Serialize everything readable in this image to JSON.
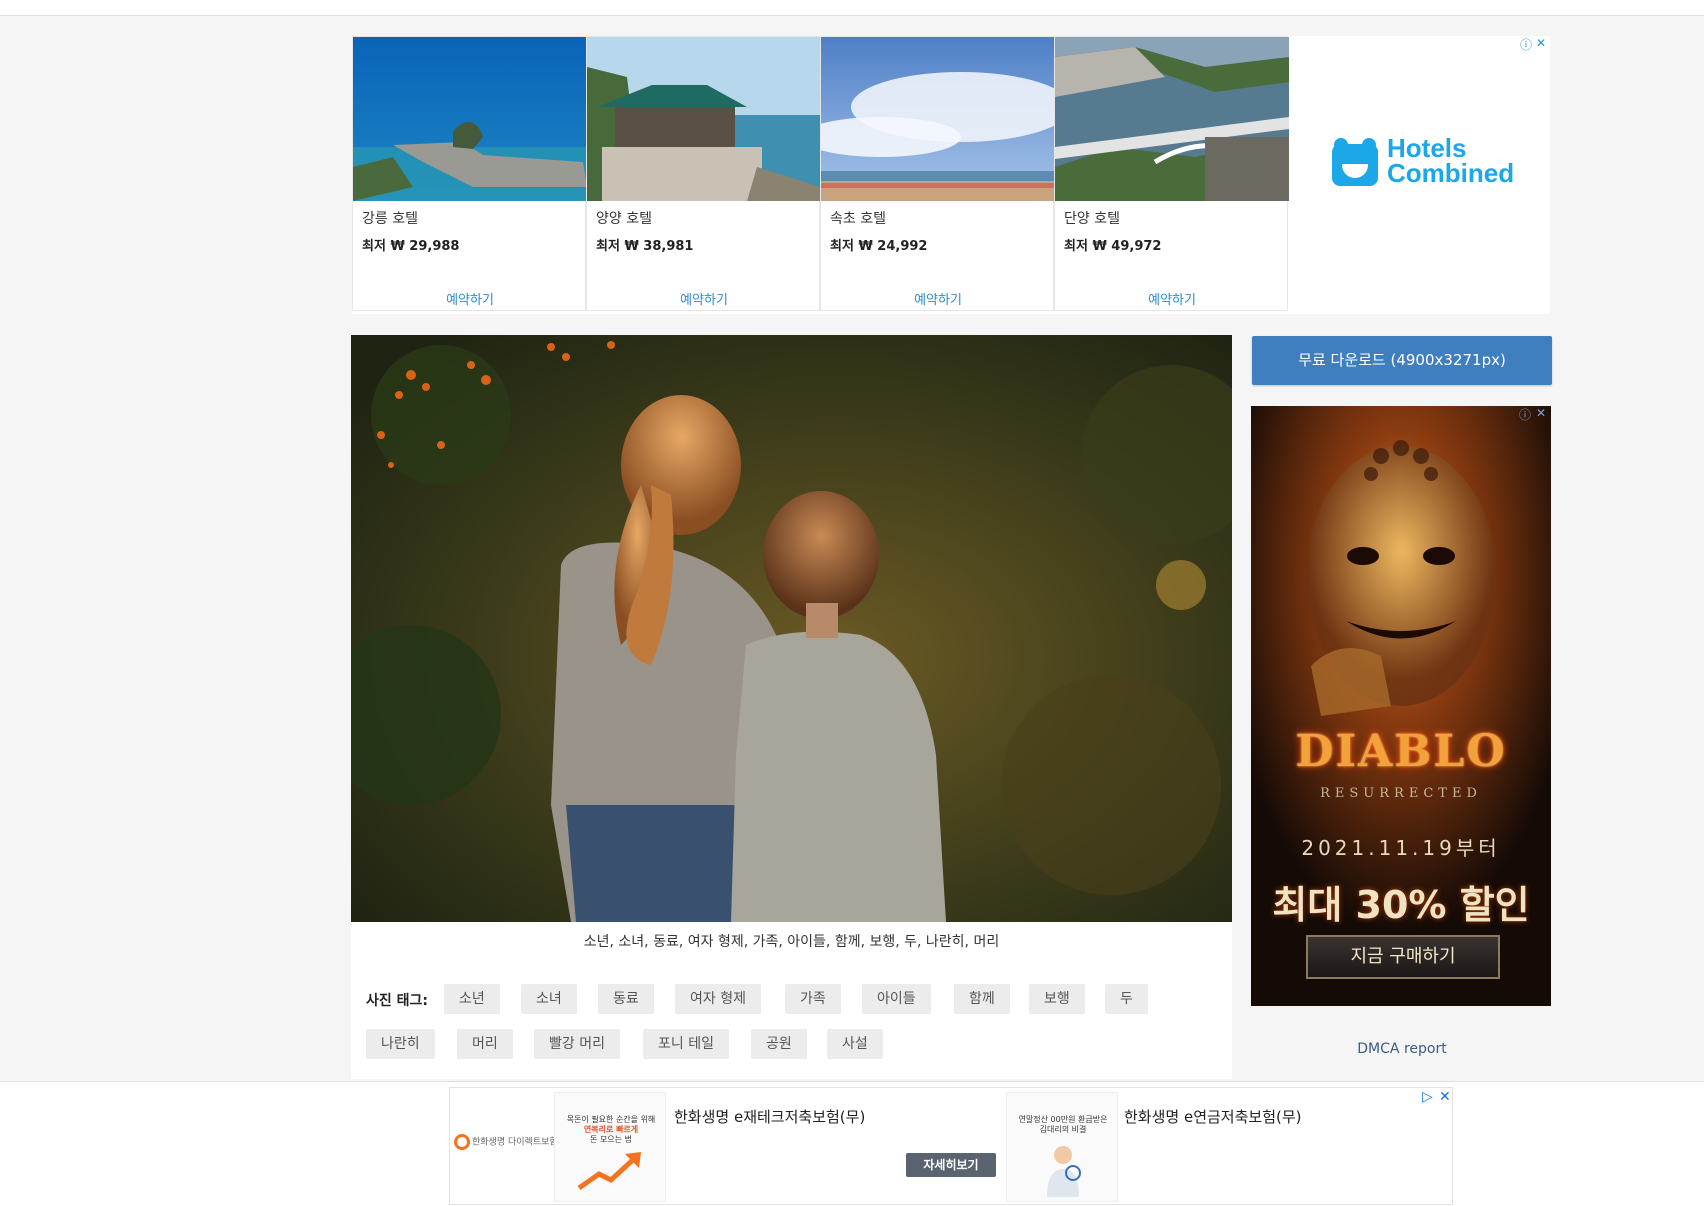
{
  "hotel_ad": {
    "hotels": [
      {
        "name": "강릉 호텔",
        "price": "최저 ₩ 29,988",
        "cta": "예약하기"
      },
      {
        "name": "양양 호텔",
        "price": "최저 ₩ 38,981",
        "cta": "예약하기"
      },
      {
        "name": "속초 호텔",
        "price": "최저 ₩ 24,992",
        "cta": "예약하기"
      },
      {
        "name": "단양 호텔",
        "price": "최저 ₩ 49,972",
        "cta": "예약하기"
      }
    ],
    "brand_line1": "Hotels",
    "brand_line2": "Combined",
    "brand_color": "#1ba7e8",
    "ad_choices_icon": "info-icon",
    "close_icon": "close-icon",
    "info_glyph": "ⓘ",
    "close_glyph": "✕"
  },
  "photo": {
    "caption": "소년, 소녀, 동료, 여자 형제, 가족, 아이들, 함께, 보행, 두, 나란히, 머리",
    "tags_label": "사진 태그:",
    "tags": [
      "소년",
      "소녀",
      "동료",
      "여자 형제",
      "가족",
      "아이들",
      "함께",
      "보행",
      "두",
      "나란히",
      "머리",
      "빨강 머리",
      "포니 테일",
      "공원",
      "사설"
    ]
  },
  "sidebar": {
    "download_label": "무료 다운로드 (4900x3271px)",
    "download_color": "#3f7fbf",
    "dmca_label": "DMCA report"
  },
  "diablo_ad": {
    "logo": "DIABLO",
    "subtitle": "RESURRECTED",
    "date": "2021.11.19부터",
    "sale": "최대 30% 할인",
    "cta": "지금 구매하기",
    "info_glyph": "ⓘ",
    "close_glyph": "✕"
  },
  "bottom_ad": {
    "advertiser": "한화생명 다이렉트보험",
    "product1": "한화생명 e재테크저축보험(무)",
    "product2": "한화생명 e연금저축보험(무)",
    "more_label": "자세히보기",
    "thumb1_lines": [
      "목돈이 필요한 순간을 위해",
      "연복리로 빠르게",
      "돈 모으는 법"
    ],
    "thumb2_lines": [
      "연말정산 00만원 환급받은",
      "김대리의 비결"
    ],
    "play_glyph": "▷",
    "close_glyph": "✕",
    "accent_color": "#f37321"
  }
}
